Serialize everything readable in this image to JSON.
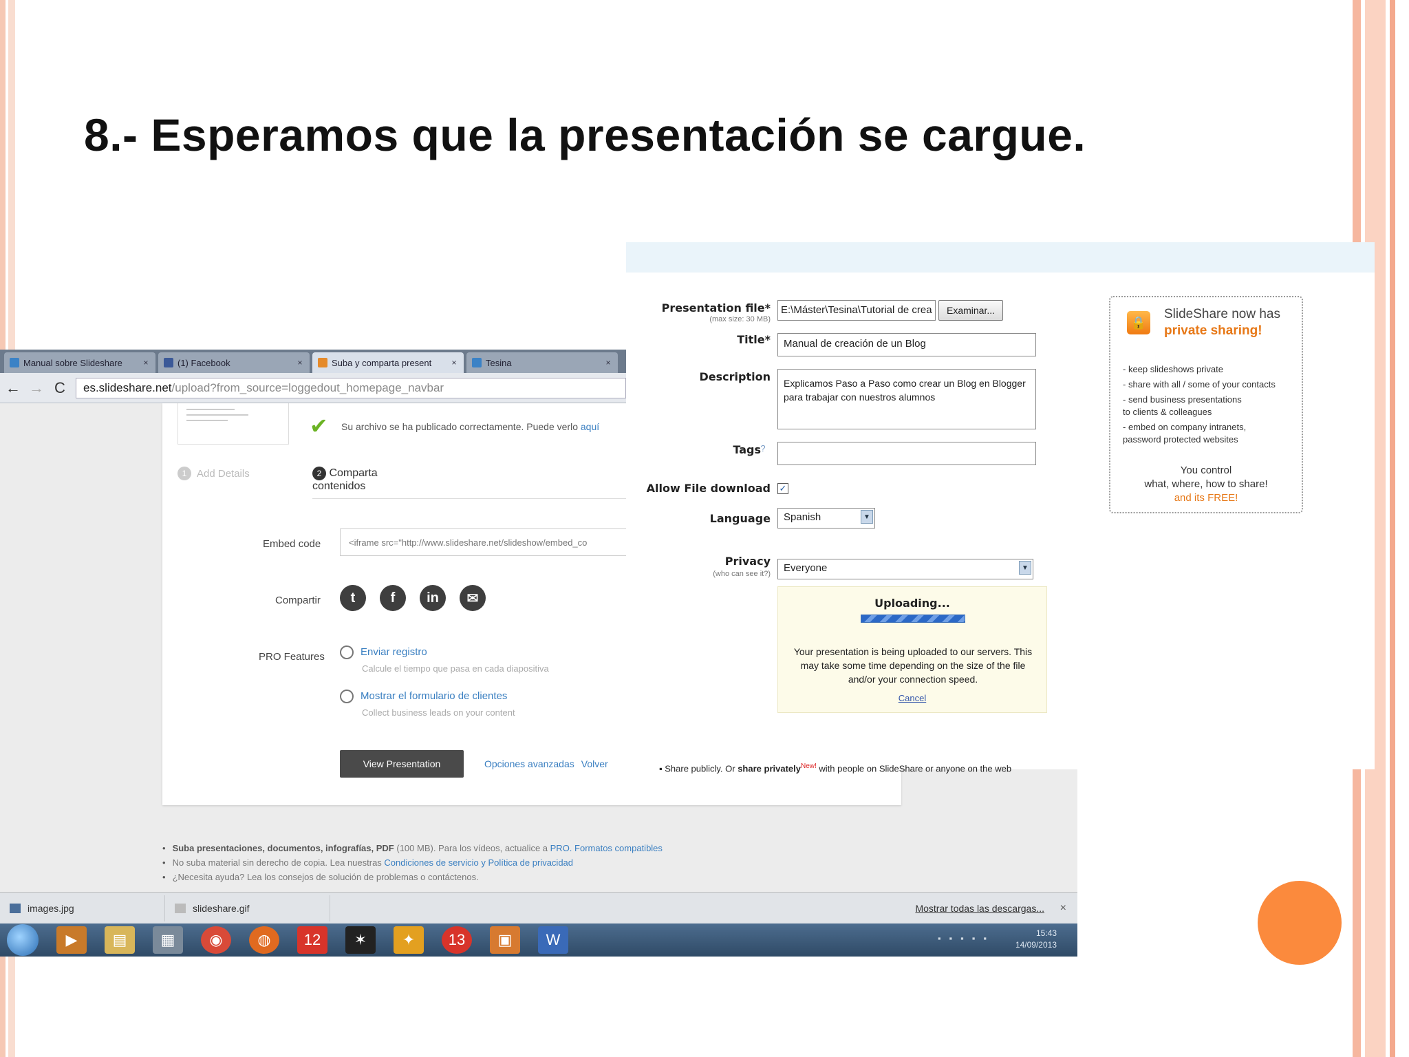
{
  "slide": {
    "title": "8.- Esperamos que la presentación se cargue."
  },
  "browser": {
    "tabs": [
      {
        "label": "Manual sobre Slideshare",
        "close": "×",
        "color": "#3b82c6"
      },
      {
        "label": "(1) Facebook",
        "close": "×",
        "color": "#3b5998"
      },
      {
        "label": "Suba y comparta present",
        "close": "×",
        "color": "#e58a2a"
      },
      {
        "label": "Tesina",
        "close": "×",
        "color": "#3b82c6"
      }
    ],
    "nav": {
      "back": "←",
      "forward": "→",
      "reload": "C"
    },
    "url_host": "es.slideshare.net",
    "url_path": "/upload?from_source=loggedout_homepage_navbar"
  },
  "bg_page": {
    "success_text": "Su archivo se ha publicado correctamente. Puede verlo ",
    "success_link": "aquí",
    "step1_num": "1",
    "step1_label": "Add Details",
    "step2_num": "2",
    "step2_label_1": "Comparta",
    "step2_label_2": "contenidos",
    "embed_label": "Embed code",
    "embed_value": "<iframe src=\"http://www.slideshare.net/slideshow/embed_co",
    "share_label": "Compartir",
    "share_icons": [
      "t",
      "f",
      "in",
      "✉"
    ],
    "pro_label": "PRO Features",
    "pro_items": [
      {
        "label": "Enviar registro",
        "sub": "Calcule el tiempo que pasa en cada diapositiva"
      },
      {
        "label": "Mostrar el formulario de clientes",
        "sub": "Collect business leads on your content"
      }
    ],
    "view_button": "View Presentation",
    "advanced_link": "Opciones avanzadas",
    "back_link": "Volver",
    "footer_notes": [
      {
        "bold": "Suba presentaciones, documentos, infografías, PDF",
        "text": " (100 MB). Para los vídeos, actualice a ",
        "link": "PRO. Formatos compatibles"
      },
      {
        "bold": "",
        "text": "No suba material sin derecho de copia. Lea nuestras ",
        "link": "Condiciones de servicio y Política de privacidad"
      },
      {
        "bold": "",
        "text": "¿Necesita ayuda? Lea los consejos de solución de problemas o contáctenos.",
        "link": ""
      }
    ]
  },
  "downloads": {
    "items": [
      {
        "label": "images.jpg"
      },
      {
        "label": "slideshare.gif"
      }
    ],
    "show_all": "Mostrar todas las descargas...",
    "close": "×"
  },
  "taskbar": {
    "time": "15:43",
    "date": "14/09/2013",
    "apps": [
      "▶",
      "▤",
      "▦",
      "◉",
      "◍",
      "12",
      "✶",
      "✦",
      "13",
      "▣",
      "W"
    ]
  },
  "upload_form": {
    "file_label": "Presentation file*",
    "file_sub": "(max size: 30 MB)",
    "file_value": "E:\\Máster\\Tesina\\Tutorial de crea",
    "browse_button": "Examinar...",
    "title_label": "Title*",
    "title_value": "Manual de creación de un Blog",
    "description_label": "Description",
    "description_value": "Explicamos Paso a Paso como crear un Blog en Blogger para trabajar con nuestros alumnos",
    "tags_label": "Tags",
    "tags_help": "?",
    "tags_value": "",
    "download_label": "Allow File download",
    "download_checked": "✓",
    "language_label": "Language",
    "language_value": "Spanish",
    "privacy_label": "Privacy",
    "privacy_sub": "(who can see it?)",
    "privacy_value": "Everyone",
    "select_arrow": "▼",
    "uploading_title": "Uploading...",
    "uploading_progress": 1.0,
    "uploading_msg": "Your presentation is being uploaded to our servers. This may take some time depending on the size of the file and/or your connection speed.",
    "cancel_link": "Cancel",
    "share_line_a": "Share publicly. Or ",
    "share_line_b": "share privately",
    "share_line_new": "New!",
    "share_line_c": " with people on SlideShare or anyone on the web"
  },
  "promo": {
    "lock": "🔒",
    "heading_1": "SlideShare now has",
    "heading_2": "private sharing!",
    "bullets": [
      "- keep slideshows private",
      "- share with all / some of your contacts",
      "- send business presentations",
      "  to clients & colleagues",
      "- embed on company intranets,",
      "  password protected websites"
    ],
    "foot_1": "You control",
    "foot_2": "what, where, how to share!",
    "foot_3": "and its FREE!"
  }
}
